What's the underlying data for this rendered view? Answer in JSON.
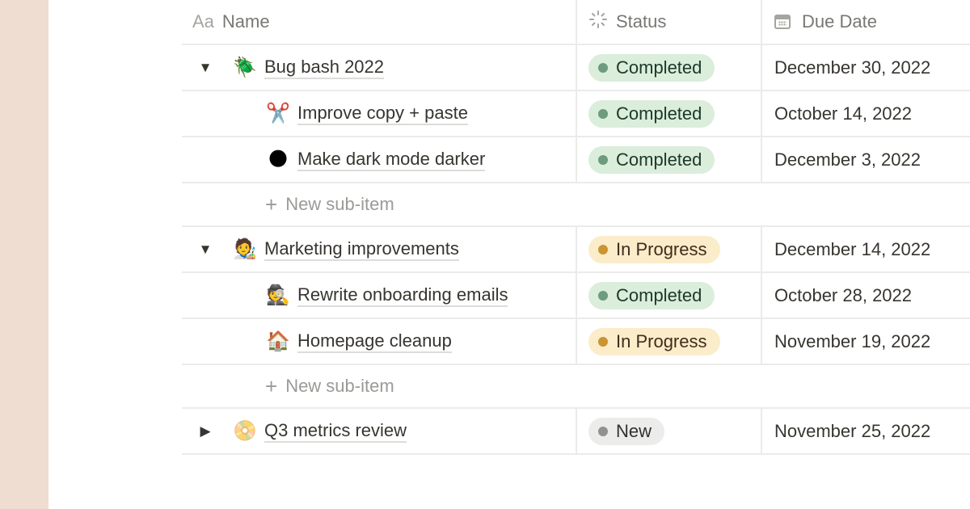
{
  "columns": {
    "name": {
      "icon": "Aa",
      "label": "Name"
    },
    "status": {
      "icon": "⁂",
      "label": "Status"
    },
    "due": {
      "label": "Due Date"
    }
  },
  "statuses": {
    "Completed": {
      "bg": "#dbeddb",
      "dot": "#6c9b7d",
      "text": "#1c3829"
    },
    "In Progress": {
      "bg": "#fbecca",
      "dot": "#cb9433",
      "text": "#402c1b"
    },
    "New": {
      "bg": "#ececeb",
      "dot": "#91918e",
      "text": "#32302c"
    }
  },
  "rows": [
    {
      "type": "item",
      "level": 0,
      "toggle": "▼",
      "emoji": "🪲",
      "title": "Bug bash 2022",
      "status": "Completed",
      "due": "December 30, 2022"
    },
    {
      "type": "item",
      "level": 1,
      "toggle": "",
      "emoji": "✂️",
      "title": "Improve copy + paste",
      "status": "Completed",
      "due": "October 14, 2022"
    },
    {
      "type": "item",
      "level": 1,
      "toggle": "",
      "emoji": "🌑",
      "title": "Make dark mode darker",
      "status": "Completed",
      "due": "December 3, 2022"
    },
    {
      "type": "new",
      "plus": "+",
      "label": "New sub-item"
    },
    {
      "type": "item",
      "level": 0,
      "toggle": "▼",
      "emoji": "🧑‍🎨",
      "title": "Marketing improvements",
      "status": "In Progress",
      "due": "December 14, 2022"
    },
    {
      "type": "item",
      "level": 1,
      "toggle": "",
      "emoji": "🕵️",
      "title": "Rewrite onboarding emails",
      "status": "Completed",
      "due": "October 28, 2022"
    },
    {
      "type": "item",
      "level": 1,
      "toggle": "",
      "emoji": "🏠",
      "title": "Homepage cleanup",
      "status": "In Progress",
      "due": "November 19, 2022"
    },
    {
      "type": "new",
      "plus": "+",
      "label": "New sub-item"
    },
    {
      "type": "item",
      "level": 0,
      "toggle": "▶",
      "emoji": "📀",
      "title": "Q3 metrics review",
      "status": "New",
      "due": "November 25, 2022"
    }
  ]
}
